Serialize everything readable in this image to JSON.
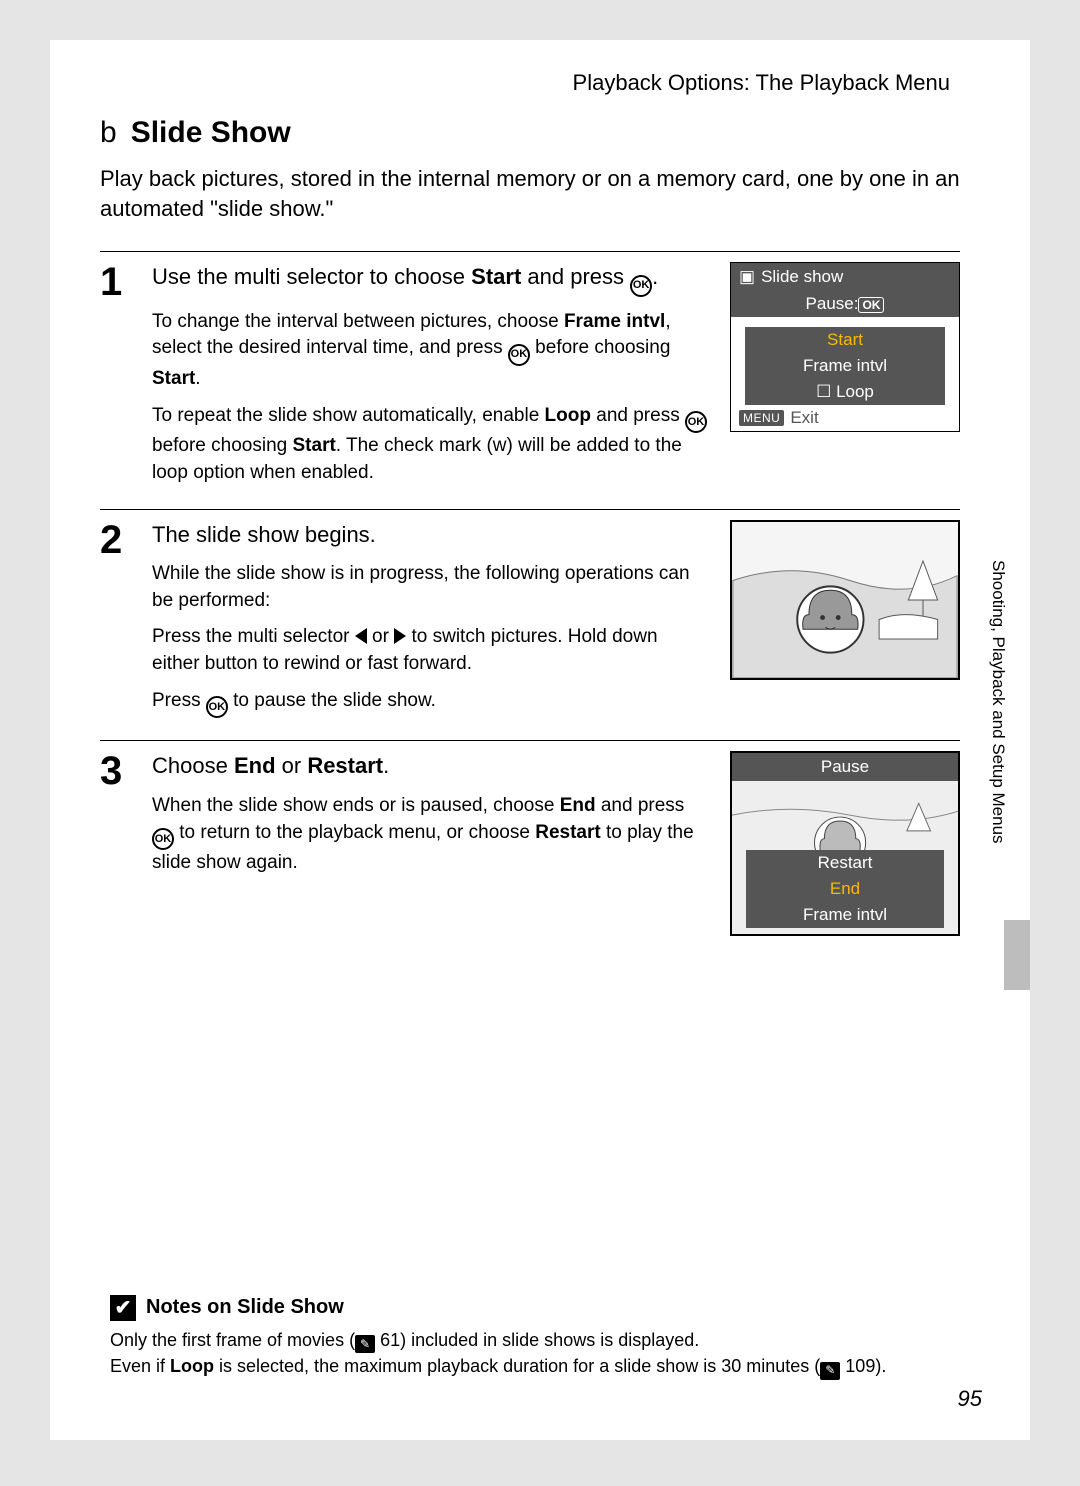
{
  "header": {
    "section": "Playback Options: The Playback Menu"
  },
  "title": {
    "icon": "b",
    "text": "Slide Show"
  },
  "intro": "Play back pictures, stored in the internal memory or on a memory card, one by one in an automated \"slide show.\"",
  "steps": [
    {
      "num": "1",
      "head_before": "Use the multi selector to choose ",
      "head_bold": "Start",
      "head_after": " and press ",
      "paras": [
        {
          "pre": "To change the interval between pictures, choose ",
          "b1": "Frame intvl",
          "mid1": ", select the desired interval time, and press ",
          "mid2": " before choosing ",
          "b2": "Start",
          "post": "."
        },
        {
          "pre": "To repeat the slide show automatically, enable ",
          "b1": "Loop",
          "mid1": " and press ",
          "mid2": " before choosing ",
          "b2": "Start",
          "post2": ". The check mark (",
          "w": "w",
          "post3": ") will be added to the loop option when enabled."
        }
      ],
      "lcd": {
        "title": "Slide show",
        "pause": "Pause:",
        "start": "Start",
        "frame": "Frame intvl",
        "loop": "Loop",
        "exit": "Exit",
        "menu": "MENU"
      }
    },
    {
      "num": "2",
      "head": "The slide show begins.",
      "p1": "While the slide show is in progress, the following operations can be performed:",
      "p2a": "Press the multi selector ",
      "p2b": " or ",
      "p2c": " to switch pictures. Hold down either button to rewind or fast forward.",
      "p3a": "Press ",
      "p3b": " to pause the slide show."
    },
    {
      "num": "3",
      "head_before": "Choose ",
      "head_b1": "End",
      "head_mid": " or ",
      "head_b2": "Restart",
      "head_after": ".",
      "p_pre": "When the slide show ends or is paused, choose ",
      "p_b1": "End",
      "p_mid1": " and press ",
      "p_mid2": " to return to the playback menu, or choose ",
      "p_b2": "Restart",
      "p_post": " to play the slide show again.",
      "lcd": {
        "pause": "Pause",
        "restart": "Restart",
        "end": "End",
        "frame": "Frame intvl"
      }
    }
  ],
  "notes": {
    "title": "Notes on Slide Show",
    "l1a": "Only the first frame of movies (",
    "l1b": " 61) included in slide shows is displayed.",
    "l2a": "Even if ",
    "l2b": "Loop",
    "l2c": " is selected, the maximum playback duration for a slide show is 30 minutes (",
    "l2d": " 109)."
  },
  "side_label": "Shooting, Playback and Setup Menus",
  "page_number": "95"
}
